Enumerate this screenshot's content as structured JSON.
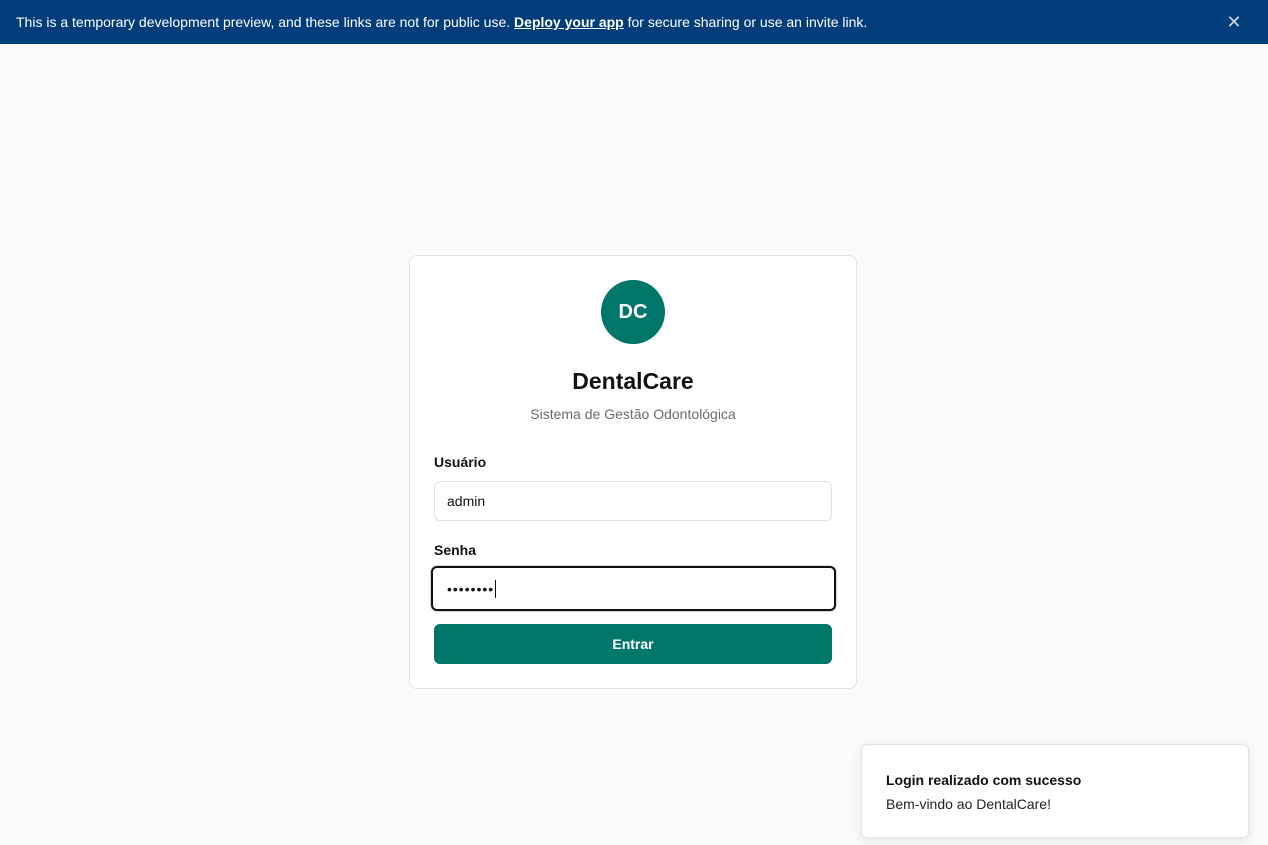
{
  "banner": {
    "text_before": "This is a temporary development preview, and these links are not for public use.",
    "link": "Deploy your app",
    "text_after": "for secure sharing or use an invite link.",
    "close_glyph": "✕"
  },
  "login": {
    "logo_text": "DC",
    "title": "DentalCare",
    "subtitle": "Sistema de Gestão Odontológica",
    "username_label": "Usuário",
    "username_value": "admin",
    "password_label": "Senha",
    "password_masked": "••••••••",
    "submit_label": "Entrar"
  },
  "toast": {
    "title": "Login realizado com sucesso",
    "description": "Bem-vindo ao DentalCare!"
  },
  "colors": {
    "banner": "#003d7a",
    "accent": "#00776a",
    "background": "#fafafa"
  }
}
